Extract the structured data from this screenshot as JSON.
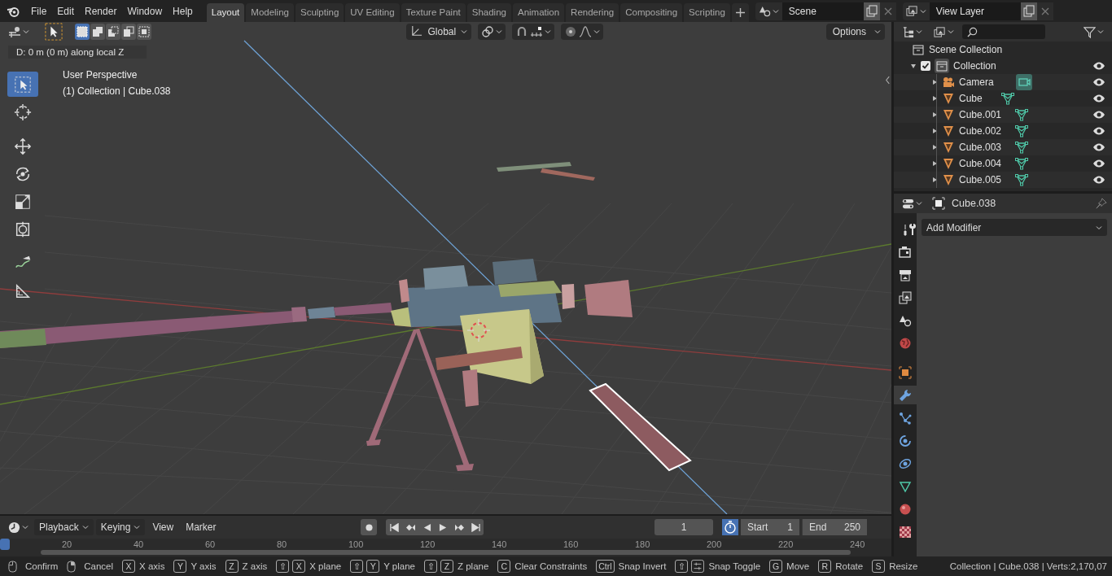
{
  "menu": [
    "File",
    "Edit",
    "Render",
    "Window",
    "Help"
  ],
  "workspaces": [
    {
      "label": "Layout",
      "selected": true
    },
    {
      "label": "Modeling",
      "selected": false
    },
    {
      "label": "Sculpting",
      "selected": false
    },
    {
      "label": "UV Editing",
      "selected": false
    },
    {
      "label": "Texture Paint",
      "selected": false
    },
    {
      "label": "Shading",
      "selected": false
    },
    {
      "label": "Animation",
      "selected": false
    },
    {
      "label": "Rendering",
      "selected": false
    },
    {
      "label": "Compositing",
      "selected": false
    },
    {
      "label": "Scripting",
      "selected": false
    }
  ],
  "scene": {
    "name": "Scene"
  },
  "view_layer": {
    "name": "View Layer"
  },
  "viewport": {
    "select_modes": [
      {
        "kind": "set",
        "selected": true
      },
      {
        "kind": "extend",
        "selected": false
      },
      {
        "kind": "subtract",
        "selected": false
      },
      {
        "kind": "invert",
        "selected": false
      },
      {
        "kind": "intersect",
        "selected": false
      }
    ],
    "orientation": "Global",
    "options": "Options",
    "operator_hint": "D: 0 m (0 m) along local Z",
    "view_name": "User Perspective",
    "object_info": "(1) Collection | Cube.038",
    "tools": [
      {
        "kind": "select",
        "selected": true
      },
      {
        "kind": "cursor",
        "selected": false
      },
      {
        "kind": "move",
        "selected": false
      },
      {
        "kind": "rotate",
        "selected": false
      },
      {
        "kind": "scale",
        "selected": false
      },
      {
        "kind": "transform",
        "selected": false
      },
      {
        "kind": "annotate",
        "selected": false
      },
      {
        "kind": "measure",
        "selected": false
      }
    ]
  },
  "outliner": {
    "root": "Scene Collection",
    "items": [
      {
        "name": "Collection",
        "kind": "collection",
        "expanded": true,
        "checked": true,
        "visible": true,
        "children": [
          {
            "name": "Camera",
            "kind": "camera",
            "expanded": false,
            "visible": true
          },
          {
            "name": "Cube",
            "kind": "mesh",
            "expanded": false,
            "visible": true
          },
          {
            "name": "Cube.001",
            "kind": "mesh",
            "expanded": false,
            "visible": true
          },
          {
            "name": "Cube.002",
            "kind": "mesh",
            "expanded": false,
            "visible": true
          },
          {
            "name": "Cube.003",
            "kind": "mesh",
            "expanded": false,
            "visible": true
          },
          {
            "name": "Cube.004",
            "kind": "mesh",
            "expanded": false,
            "visible": true
          },
          {
            "name": "Cube.005",
            "kind": "mesh",
            "expanded": false,
            "visible": true
          }
        ]
      }
    ]
  },
  "properties": {
    "object": "Cube.038",
    "add_modifier": "Add Modifier",
    "tabs": [
      {
        "kind": "tool",
        "selected": false
      },
      {
        "kind": "render",
        "selected": false
      },
      {
        "kind": "output",
        "selected": false
      },
      {
        "kind": "view-layer",
        "selected": false
      },
      {
        "kind": "scene",
        "selected": false
      },
      {
        "kind": "world",
        "selected": false
      },
      {
        "kind": "object",
        "selected": false
      },
      {
        "kind": "modifier",
        "selected": true
      },
      {
        "kind": "particles",
        "selected": false
      },
      {
        "kind": "physics",
        "selected": false
      },
      {
        "kind": "constraints",
        "selected": false
      },
      {
        "kind": "data",
        "selected": false
      },
      {
        "kind": "material",
        "selected": false
      },
      {
        "kind": "texture",
        "selected": false
      }
    ]
  },
  "timeline": {
    "menus": [
      "Playback",
      "Keying",
      "View",
      "Marker"
    ],
    "current_frame": "1",
    "start_label": "Start",
    "start": "1",
    "end_label": "End",
    "end": "250",
    "ruler": [
      "20",
      "40",
      "60",
      "80",
      "100",
      "120",
      "140",
      "160",
      "180",
      "200",
      "220",
      "240"
    ]
  },
  "status_bar": {
    "hints": [
      {
        "kind": "mouse-left",
        "label": "Confirm"
      },
      {
        "kind": "mouse-right",
        "label": "Cancel"
      },
      {
        "kind": "keys",
        "keys": [
          "X"
        ],
        "label": "X axis"
      },
      {
        "kind": "keys",
        "keys": [
          "Y"
        ],
        "label": "Y axis"
      },
      {
        "kind": "keys",
        "keys": [
          "Z"
        ],
        "label": "Z axis"
      },
      {
        "kind": "keys",
        "keys": [
          "⇧",
          "X"
        ],
        "label": "X plane"
      },
      {
        "kind": "keys",
        "keys": [
          "⇧",
          "Y"
        ],
        "label": "Y plane"
      },
      {
        "kind": "keys",
        "keys": [
          "⇧",
          "Z"
        ],
        "label": "Z plane"
      },
      {
        "kind": "keys",
        "keys": [
          "C"
        ],
        "label": "Clear Constraints"
      },
      {
        "kind": "keys",
        "keys": [
          "Ctrl"
        ],
        "label": "Snap Invert"
      },
      {
        "kind": "keys-snap",
        "keys": [
          "⇧"
        ],
        "label": "Snap Toggle"
      },
      {
        "kind": "keys",
        "keys": [
          "G"
        ],
        "label": "Move"
      },
      {
        "kind": "keys",
        "keys": [
          "R"
        ],
        "label": "Rotate"
      },
      {
        "kind": "keys",
        "keys": [
          "S"
        ],
        "label": "Resize"
      }
    ],
    "stats": "Collection | Cube.038 | Verts:2,170,07"
  }
}
